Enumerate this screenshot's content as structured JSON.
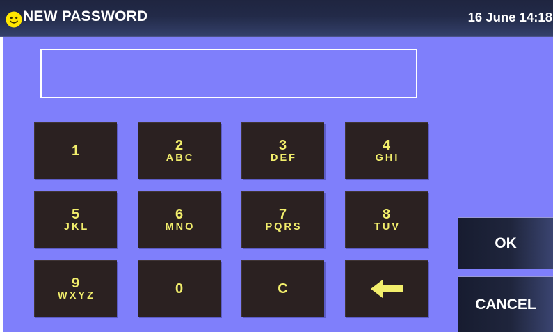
{
  "header": {
    "title": "NEW PASSWORD",
    "datetime": "16 June 14:18",
    "status_icon": "smiley-icon"
  },
  "password_field": {
    "value": ""
  },
  "keypad": {
    "keys": [
      {
        "digit": "1",
        "letters": ""
      },
      {
        "digit": "2",
        "letters": "ABC"
      },
      {
        "digit": "3",
        "letters": "DEF"
      },
      {
        "digit": "4",
        "letters": "GHI"
      },
      {
        "digit": "5",
        "letters": "JKL"
      },
      {
        "digit": "6",
        "letters": "MNO"
      },
      {
        "digit": "7",
        "letters": "PQRS"
      },
      {
        "digit": "8",
        "letters": "TUV"
      },
      {
        "digit": "9",
        "letters": "WXYZ"
      },
      {
        "digit": "0",
        "letters": ""
      },
      {
        "digit": "C",
        "letters": ""
      }
    ],
    "backspace_icon": "left-arrow-icon"
  },
  "buttons": {
    "ok": "OK",
    "cancel": "CANCEL"
  },
  "colors": {
    "panel": "#7f7ffb",
    "key_background": "#2b2121",
    "key_text": "#f2ee6c",
    "header": "#222a48",
    "smiley": "#ffe600"
  }
}
